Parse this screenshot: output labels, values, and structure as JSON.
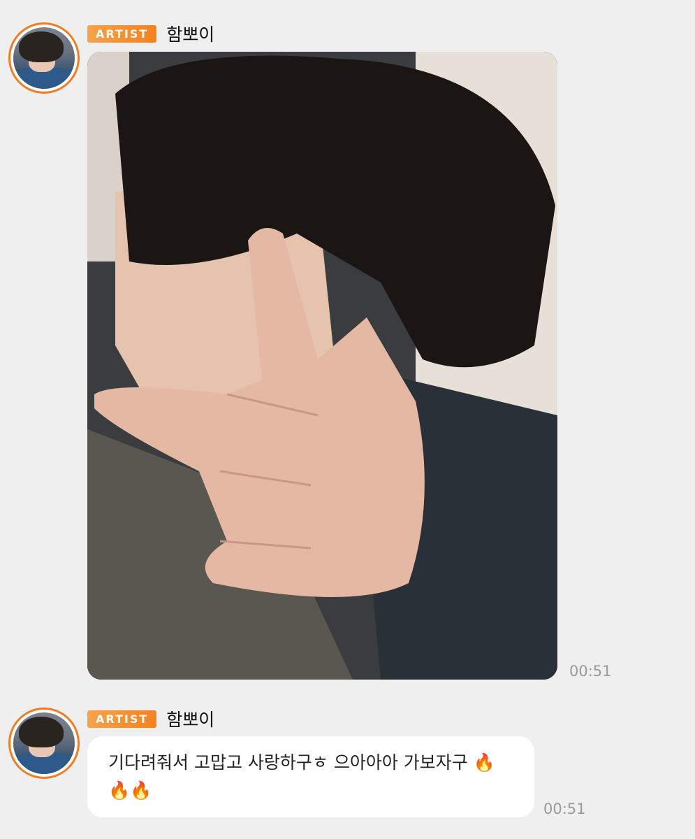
{
  "messages": [
    {
      "badge": "ARTIST",
      "sender": "함뽀이",
      "type": "image",
      "time": "00:51"
    },
    {
      "badge": "ARTIST",
      "sender": "함뽀이",
      "type": "text",
      "text": "기다려줘서 고맙고 사랑하구ㅎ 으아아아 가보자구 🔥🔥🔥",
      "time": "00:51"
    }
  ],
  "colors": {
    "background": "#efefef",
    "badge": "#f4811f",
    "avatar_ring": "#f47b20",
    "bubble": "#ffffff",
    "timestamp": "#9a9a9a"
  }
}
